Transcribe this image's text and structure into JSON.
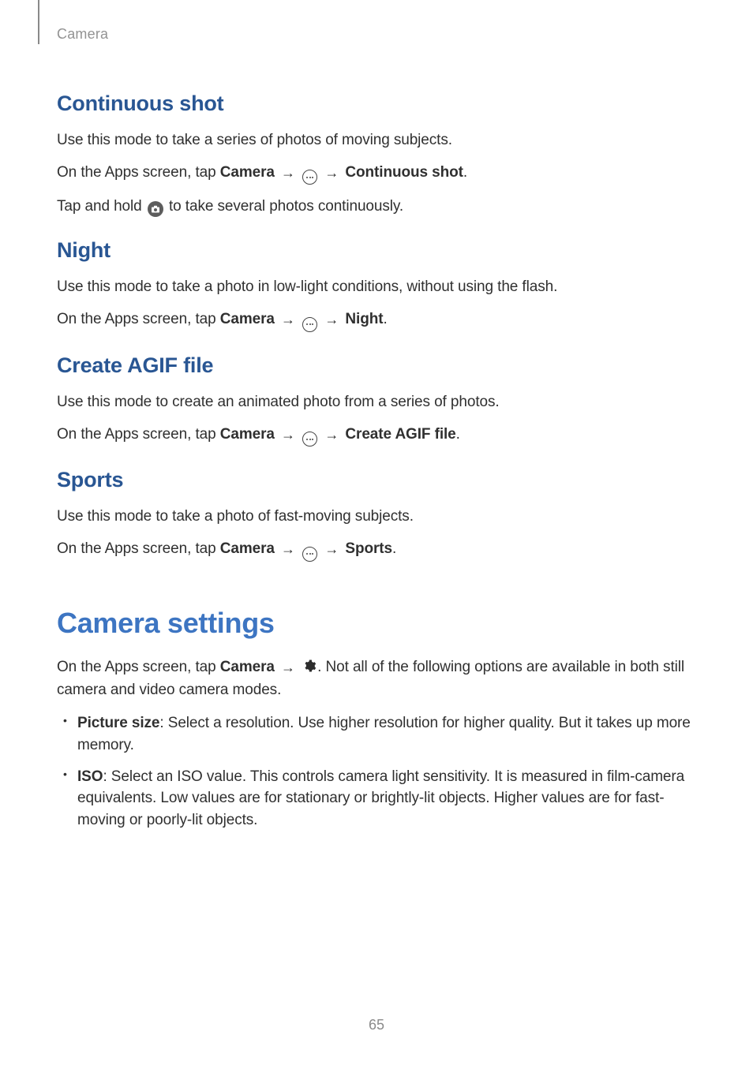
{
  "breadcrumb": "Camera",
  "pageNumber": "65",
  "strings": {
    "arrow": "→",
    "camera": "Camera",
    "onApps": "On the Apps screen, tap ",
    "period": "."
  },
  "sections": [
    {
      "heading": "Continuous shot",
      "p1": "Use this mode to take a series of photos of moving subjects.",
      "target": "Continuous shot",
      "p3_a": "Tap and hold ",
      "p3_b": " to take several photos continuously."
    },
    {
      "heading": "Night",
      "p1": "Use this mode to take a photo in low-light conditions, without using the flash.",
      "target": "Night"
    },
    {
      "heading": "Create AGIF file",
      "p1": "Use this mode to create an animated photo from a series of photos.",
      "target": "Create AGIF file"
    },
    {
      "heading": "Sports",
      "p1": "Use this mode to take a photo of fast-moving subjects.",
      "target": "Sports"
    }
  ],
  "settings": {
    "heading": "Camera settings",
    "intro_b": ". Not all of the following options are available in both still camera and video camera modes.",
    "items": [
      {
        "term": "Picture size",
        "desc": ": Select a resolution. Use higher resolution for higher quality. But it takes up more memory."
      },
      {
        "term": "ISO",
        "desc": ": Select an ISO value. This controls camera light sensitivity. It is measured in film-camera equivalents. Low values are for stationary or brightly-lit objects. Higher values are for fast-moving or poorly-lit objects."
      }
    ]
  }
}
